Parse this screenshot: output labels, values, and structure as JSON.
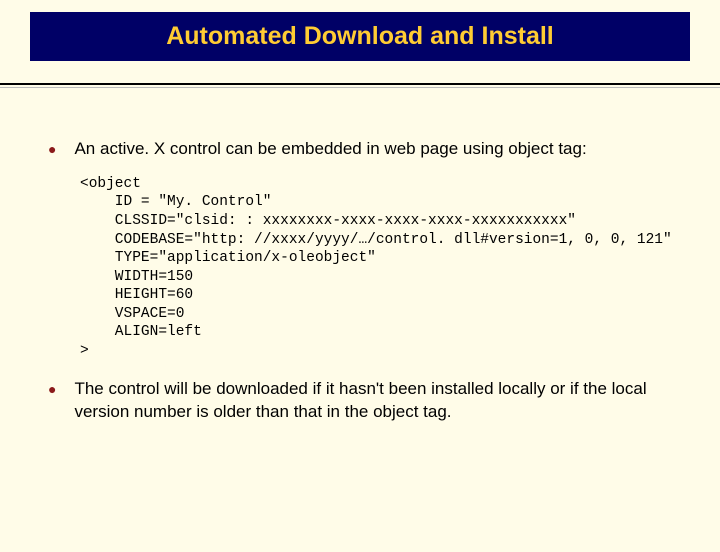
{
  "title": "Automated Download and Install",
  "bullets": {
    "b1": "An active. X control can be embedded in web page using object tag:",
    "b2": "The control will be downloaded if it hasn't been installed locally or if the local version number is older than that in the object tag."
  },
  "code": "<object\n    ID = \"My. Control\"\n    CLSSID=\"clsid: : xxxxxxxx-xxxx-xxxx-xxxx-xxxxxxxxxxx\"\n    CODEBASE=\"http: //xxxx/yyyy/…/control. dll#version=1, 0, 0, 121\"\n    TYPE=\"application/x-oleobject\"\n    WIDTH=150\n    HEIGHT=60\n    VSPACE=0\n    ALIGN=left\n>"
}
